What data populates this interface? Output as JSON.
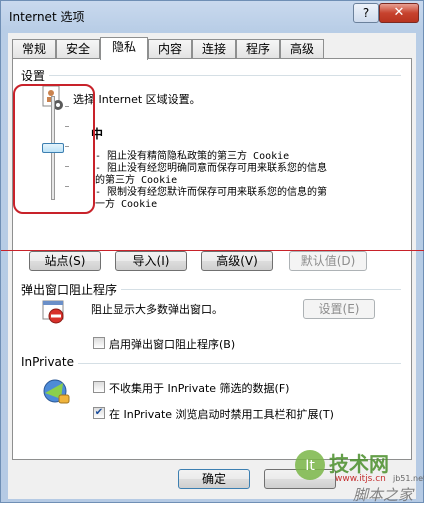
{
  "window": {
    "title": "Internet 选项",
    "help": "?",
    "close": "✕"
  },
  "tabs": [
    "常规",
    "安全",
    "隐私",
    "内容",
    "连接",
    "程序",
    "高级"
  ],
  "settings": {
    "group_label": "设置",
    "zone_label": "选择 Internet 区域设置。",
    "level": "中",
    "slider_level_fraction": 0.5,
    "desc_lines": [
      "- 阻止没有精简隐私政策的第三方 Cookie",
      "- 阻止没有经您明确同意而保存可用来联系您的信息",
      "的第三方 Cookie",
      "- 限制没有经您默许而保存可用来联系您的信息的第",
      "一方 Cookie"
    ],
    "buttons": {
      "sites": "站点(S)",
      "import": "导入(I)",
      "advanced": "高级(V)",
      "default": "默认值(D)"
    }
  },
  "popup": {
    "group_label": "弹出窗口阻止程序",
    "desc": "阻止显示大多数弹出窗口。",
    "settings_btn": "设置(E)",
    "enable_label": "启用弹出窗口阻止程序(B)",
    "enable_checked": false
  },
  "inprivate": {
    "group_label": "InPrivate",
    "filter_label": "不收集用于 InPrivate 筛选的数据(F)",
    "filter_checked": false,
    "disable_label": "在 InPrivate 浏览启动时禁用工具栏和扩展(T)",
    "disable_checked": true
  },
  "footer": {
    "ok": "确定"
  },
  "watermark": {
    "main": "技术网",
    "url": "www.itjs.cn",
    "sub": "脚本之家",
    "small": "jb51.net"
  },
  "colors": {
    "highlight_red": "#c8222a",
    "accent_blue": "#3c7fb1"
  }
}
